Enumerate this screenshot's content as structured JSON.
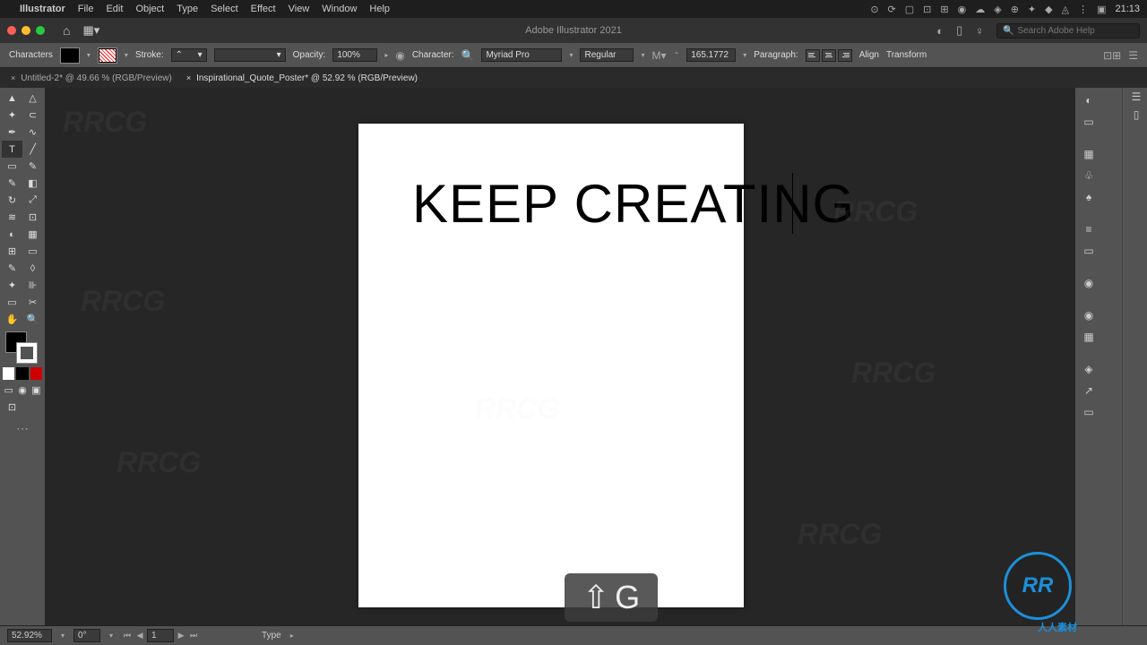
{
  "menubar": {
    "app_name": "Illustrator",
    "items": [
      "File",
      "Edit",
      "Object",
      "Type",
      "Select",
      "Effect",
      "View",
      "Window",
      "Help"
    ],
    "clock": "21:13"
  },
  "appbar": {
    "title": "Adobe Illustrator 2021",
    "search_placeholder": "Search Adobe Help"
  },
  "controlbar": {
    "mode_label": "Characters",
    "stroke_label": "Stroke:",
    "opacity_label": "Opacity:",
    "opacity_value": "100%",
    "character_label": "Character:",
    "font_family": "Myriad Pro",
    "font_style": "Regular",
    "font_size": "165.1772",
    "paragraph_label": "Paragraph:",
    "align_label": "Align",
    "transform_label": "Transform"
  },
  "tabs": [
    {
      "label": "Untitled-2* @ 49.66 % (RGB/Preview)",
      "active": false
    },
    {
      "label": "Inspirational_Quote_Poster* @ 52.92 % (RGB/Preview)",
      "active": true
    }
  ],
  "artboard": {
    "text": "KEEP CREATING"
  },
  "key_overlay": {
    "modifier": "⇧",
    "key": "G"
  },
  "statusbar": {
    "zoom": "52.92%",
    "rotation": "0°",
    "artboard_num": "1",
    "tool": "Type"
  },
  "branding": {
    "logo": "RR",
    "logo_text": "人人素材"
  }
}
